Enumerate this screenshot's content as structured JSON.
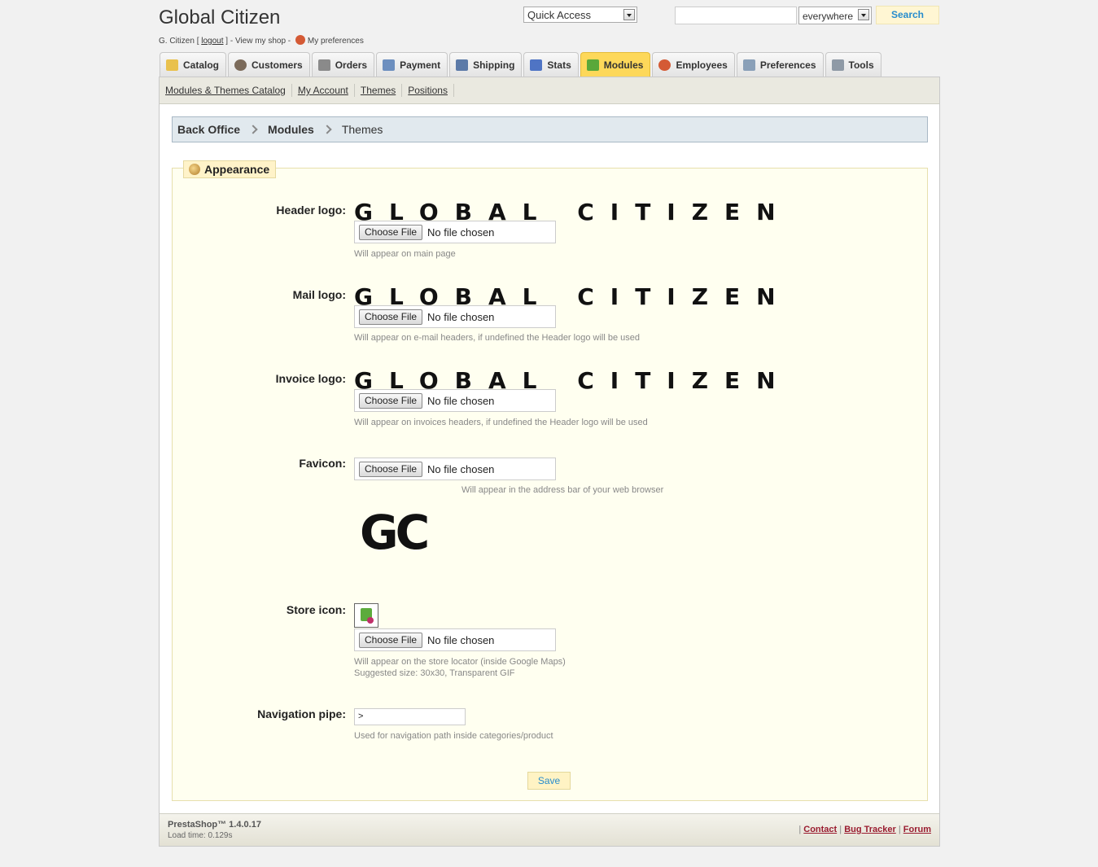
{
  "header": {
    "shop_title": "Global Citizen",
    "user_name": "G. Citizen",
    "bracket_open": "[",
    "logout_label": "logout",
    "bracket_close": "] - View my shop -",
    "preferences_label": "My preferences",
    "quick_access_label": "Quick Access",
    "search_value": "",
    "search_scope": "everywhere",
    "search_button": "Search"
  },
  "tabs": [
    {
      "label": "Catalog",
      "icon": "folder-icon",
      "color": "#e9c14d"
    },
    {
      "label": "Customers",
      "icon": "user-icon",
      "color": "#7b6a5a"
    },
    {
      "label": "Orders",
      "icon": "cart-icon",
      "color": "#8a8a8a"
    },
    {
      "label": "Payment",
      "icon": "payment-icon",
      "color": "#6d8fbf"
    },
    {
      "label": "Shipping",
      "icon": "truck-icon",
      "color": "#5c7aa8"
    },
    {
      "label": "Stats",
      "icon": "bar-chart-icon",
      "color": "#4f74c4"
    },
    {
      "label": "Modules",
      "icon": "puzzle-icon",
      "color": "#5aa83a",
      "active": true
    },
    {
      "label": "Employees",
      "icon": "employee-icon",
      "color": "#d45a35"
    },
    {
      "label": "Preferences",
      "icon": "preferences-icon",
      "color": "#8aa0b8"
    },
    {
      "label": "Tools",
      "icon": "wrench-icon",
      "color": "#8f9aa6"
    }
  ],
  "subnav": [
    "Modules & Themes Catalog",
    "My Account",
    "Themes",
    "Positions"
  ],
  "breadcrumb": {
    "item1": "Back Office",
    "item2": "Modules",
    "item3": "Themes"
  },
  "appearance": {
    "legend": "Appearance",
    "logo_text": "GLOBAL CITIZEN",
    "choose_file": "Choose File",
    "no_file": "No file chosen",
    "header_logo": {
      "label": "Header logo:",
      "hint": "Will appear on main page"
    },
    "mail_logo": {
      "label": "Mail logo:",
      "hint": "Will appear on e-mail headers, if undefined the Header logo will be used"
    },
    "invoice_logo": {
      "label": "Invoice logo:",
      "hint": "Will appear on invoices headers, if undefined the Header logo will be used"
    },
    "favicon": {
      "label": "Favicon:",
      "hint": "Will appear in the address bar of your web browser",
      "logo_text": "GC"
    },
    "store_icon": {
      "label": "Store icon:",
      "hint1": "Will appear on the store locator (inside Google Maps)",
      "hint2": "Suggested size: 30x30, Transparent GIF"
    },
    "navigation_pipe": {
      "label": "Navigation pipe:",
      "value": ">",
      "hint": "Used for navigation path inside categories/product"
    },
    "save_label": "Save"
  },
  "footer": {
    "version": "PrestaShop™ 1.4.0.17",
    "load_time": "Load time: 0.129s",
    "sep": "|",
    "links": [
      "Contact",
      "Bug Tracker",
      "Forum"
    ]
  }
}
